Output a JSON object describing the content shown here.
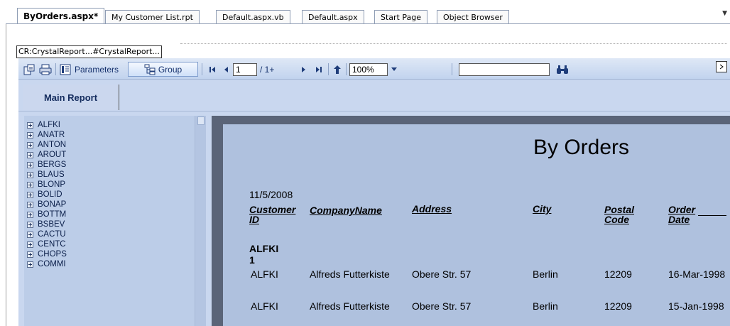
{
  "doc_tabs": [
    {
      "label": "ByOrders.aspx*",
      "active": true
    },
    {
      "label": "My Customer List.rpt",
      "active": false
    },
    {
      "label": "Default.aspx.vb",
      "active": false
    },
    {
      "label": "Default.aspx",
      "active": false
    },
    {
      "label": "Start Page",
      "active": false
    },
    {
      "label": "Object Browser",
      "active": false
    }
  ],
  "control_label": "CR:CrystalReport...#CrystalReport...",
  "toolbar": {
    "parameters_label": "Parameters",
    "group_label": "Group",
    "page_number": "1",
    "page_total": "/ 1+",
    "zoom": "100%",
    "search_value": ""
  },
  "report_tab": "Main Report",
  "group_tree": [
    "ALFKI",
    "ANATR",
    "ANTON",
    "AROUT",
    "BERGS",
    "BLAUS",
    "BLONP",
    "BOLID",
    "BONAP",
    "BOTTM",
    "BSBEV",
    "CACTU",
    "CENTC",
    "CHOPS",
    "COMMI"
  ],
  "report": {
    "title": "By Orders",
    "date": "11/5/2008",
    "headers": {
      "customer_id": [
        "Customer",
        "ID"
      ],
      "company": "CompanyName",
      "address": "Address",
      "city": "City",
      "postal": [
        "Postal",
        "Code"
      ],
      "order_date": [
        "Order",
        "Date"
      ]
    },
    "group_name": "ALFKI",
    "group_count": "1",
    "rows": [
      {
        "id": "ALFKI",
        "company": "Alfreds Futterkiste",
        "address": "Obere Str. 57",
        "city": "Berlin",
        "postal": "12209",
        "date": "16-Mar-1998"
      },
      {
        "id": "ALFKI",
        "company": "Alfreds Futterkiste",
        "address": "Obere Str. 57",
        "city": "Berlin",
        "postal": "12209",
        "date": "15-Jan-1998"
      }
    ]
  },
  "colors": {
    "viewer_bg": "#c9d7ef",
    "report_page": "#afc1de",
    "tree_bg": "#bccde8",
    "page_gutter": "#5a6478"
  },
  "icons": [
    "export-icon",
    "print-icon",
    "parameters-icon",
    "group-tree-icon",
    "first-page-icon",
    "prev-page-icon",
    "next-page-icon",
    "last-page-icon",
    "drill-up-icon",
    "zoom-dropdown-icon",
    "binoculars-icon",
    "tab-list-dropdown-icon"
  ]
}
